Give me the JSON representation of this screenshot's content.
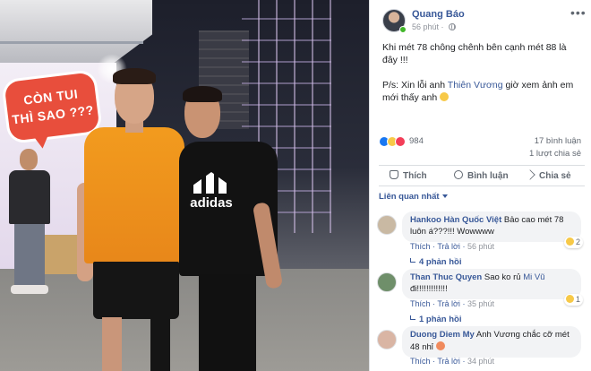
{
  "photo": {
    "bubble_text_line1": "CÒN TUI",
    "bubble_text_line2": "THÌ SAO ???",
    "shirt_logo": "adidas"
  },
  "post": {
    "author": "Quang Báo",
    "time": "56 phút",
    "text_line1": "Khi mét 78 chông chênh bên cạnh mét 88 là đây !!!",
    "ps_before": "P/s: Xin lỗi anh ",
    "ps_mention": "Thiên Vương",
    "ps_after": " giờ xem ảnh em mới thấy anh ",
    "reactions_count": "984",
    "comments_count": "17 bình luận",
    "shares_count": "1 lượt chia sẻ",
    "actions": {
      "like": "Thích",
      "comment": "Bình luận",
      "share": "Chia sẻ"
    },
    "sort_label": "Liên quan nhất"
  },
  "comments": [
    {
      "name": "Hankoo Hàn Quốc Việt",
      "text": " Bảo cao mét 78 luôn á???!!! Wowwww",
      "like": "Thích",
      "reply": "Trả lời",
      "time": "56 phút",
      "reactions": "2",
      "replies": "4 phản hồi",
      "avatar_color": "#c9b9a3"
    },
    {
      "name": "Than Thuc Quyen",
      "text_before": " Sao ko rủ ",
      "mention": "Mi Vũ",
      "text_after": " đi!!!!!!!!!!!!!",
      "like": "Thích",
      "reply": "Trả lời",
      "time": "35 phút",
      "reactions": "1",
      "replies": "1 phản hồi",
      "avatar_color": "#6f8f6a"
    },
    {
      "name": "Duong Diem My",
      "text": " Anh Vương chắc cỡ mét 48 nhỉ",
      "like": "Thích",
      "reply": "Trả lời",
      "time": "34 phút",
      "avatar_color": "#d9b5a4"
    }
  ]
}
